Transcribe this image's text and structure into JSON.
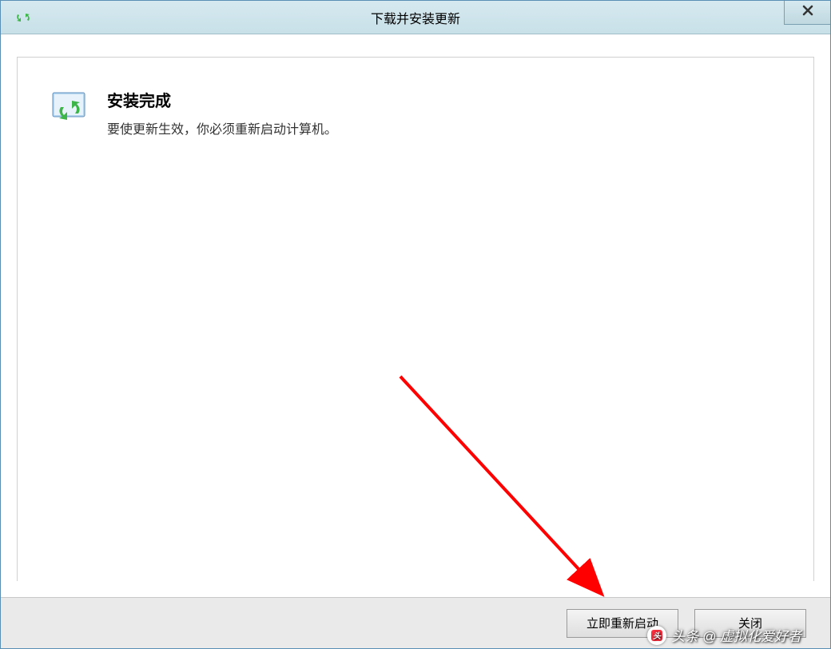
{
  "window": {
    "title": "下载并安装更新"
  },
  "content": {
    "heading": "安装完成",
    "subtext": "要使更新生效，你必须重新启动计算机。"
  },
  "footer": {
    "restart_label": "立即重新启动",
    "close_label": "关闭"
  },
  "watermark": {
    "text": "头条 @ 虚拟化爱好者"
  },
  "colors": {
    "titlebar_bg": "#c8e0e8",
    "accent_green": "#3db548",
    "arrow_red": "#ff0000"
  }
}
